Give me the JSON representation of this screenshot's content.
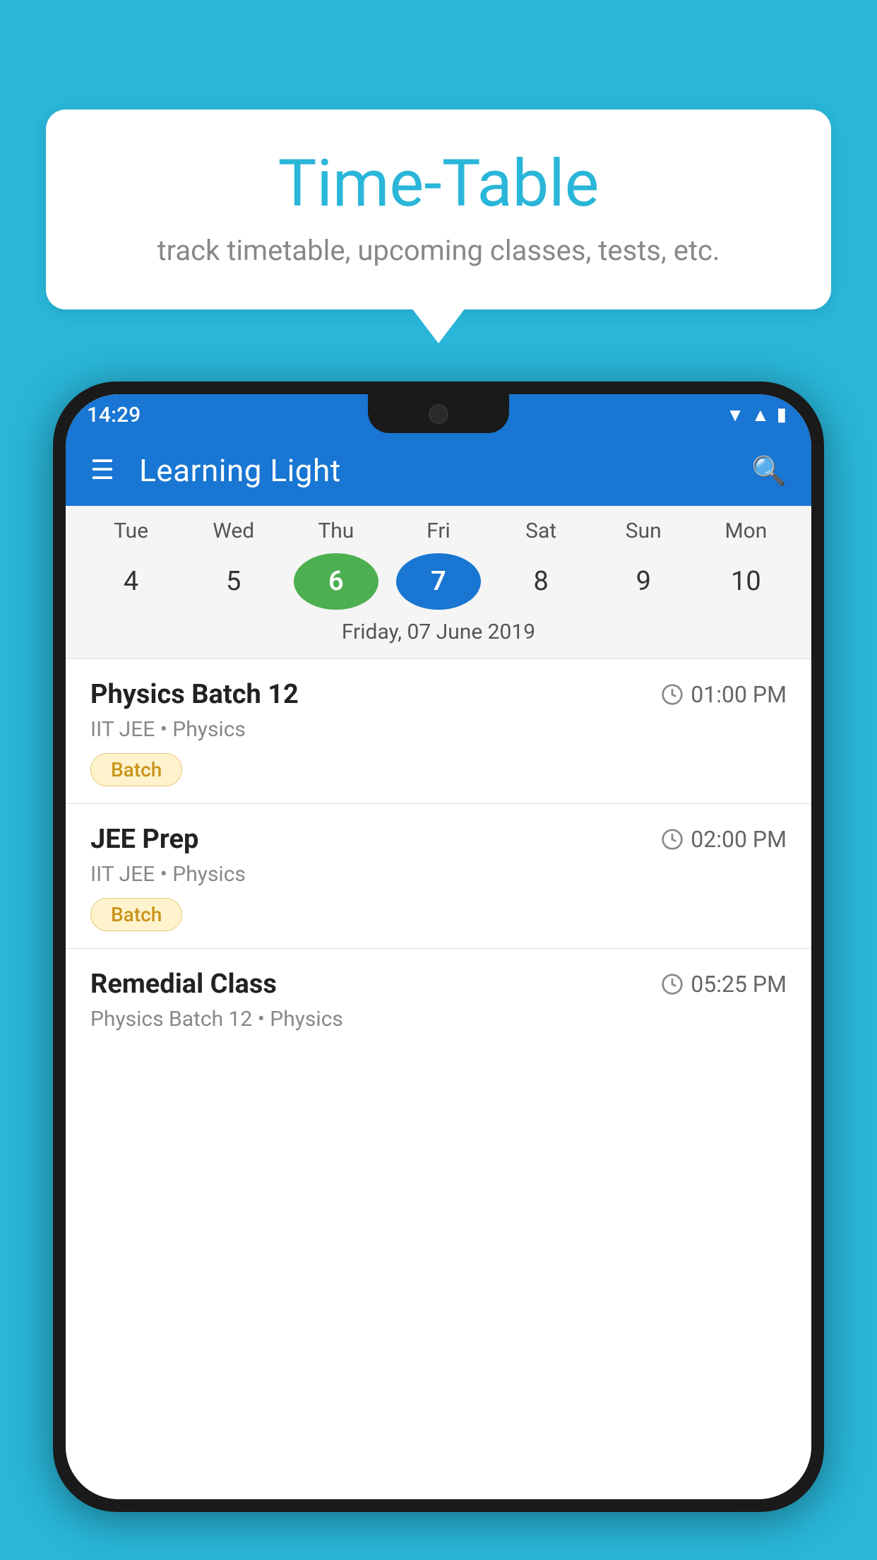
{
  "background": {
    "color": "#29b6d8"
  },
  "bubble": {
    "title": "Time-Table",
    "subtitle": "track timetable, upcoming classes, tests, etc."
  },
  "phone": {
    "status_bar": {
      "time": "14:29"
    },
    "app_bar": {
      "title": "Learning Light"
    },
    "calendar": {
      "days": [
        {
          "label": "Tue",
          "num": "4"
        },
        {
          "label": "Wed",
          "num": "5"
        },
        {
          "label": "Thu",
          "num": "6",
          "state": "today"
        },
        {
          "label": "Fri",
          "num": "7",
          "state": "selected"
        },
        {
          "label": "Sat",
          "num": "8"
        },
        {
          "label": "Sun",
          "num": "9"
        },
        {
          "label": "Mon",
          "num": "10"
        }
      ],
      "selected_date": "Friday, 07 June 2019"
    },
    "classes": [
      {
        "name": "Physics Batch 12",
        "time": "01:00 PM",
        "meta": "IIT JEE • Physics",
        "badge": "Batch"
      },
      {
        "name": "JEE Prep",
        "time": "02:00 PM",
        "meta": "IIT JEE • Physics",
        "badge": "Batch"
      },
      {
        "name": "Remedial Class",
        "time": "05:25 PM",
        "meta": "Physics Batch 12 • Physics",
        "badge": null
      }
    ]
  }
}
